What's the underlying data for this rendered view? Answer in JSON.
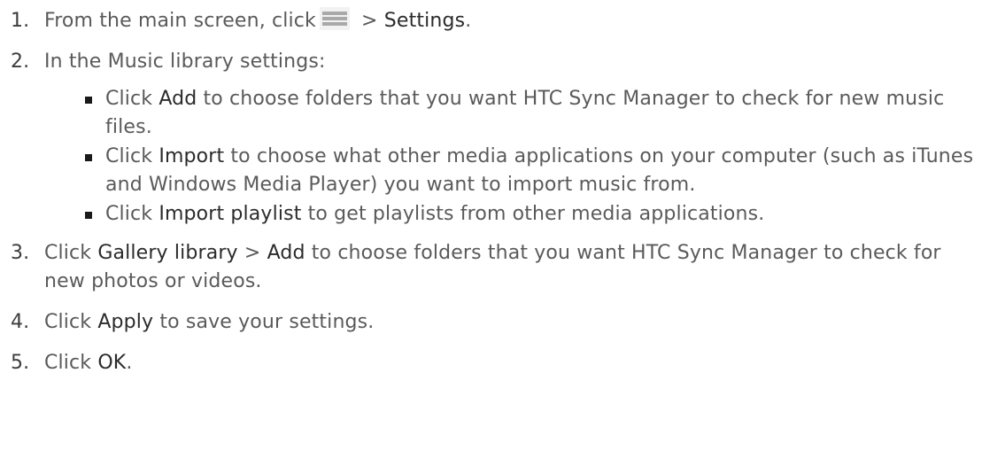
{
  "steps": [
    {
      "num": "1.",
      "t1": "From the main screen, click",
      "t2": " > ",
      "kw1": "Settings",
      "t3": "."
    },
    {
      "num": "2.",
      "t1": "In the Music library settings:",
      "bullets": [
        {
          "pre": "Click ",
          "kw": "Add",
          "post": " to choose folders that you want HTC Sync Manager to check for new music files."
        },
        {
          "pre": "Click ",
          "kw": "Import",
          "post": " to choose what other media applications on your computer (such as iTunes and Windows Media Player) you want to import music from."
        },
        {
          "pre": "Click ",
          "kw": "Import playlist",
          "post": " to get playlists from other media applications."
        }
      ]
    },
    {
      "num": "3.",
      "pre": "Click ",
      "kw1": "Gallery library",
      "mid": " > ",
      "kw2": "Add",
      "post": " to choose folders that you want HTC Sync Manager to check for new photos or videos."
    },
    {
      "num": "4.",
      "pre": "Click ",
      "kw": "Apply",
      "post": " to save your settings."
    },
    {
      "num": "5.",
      "pre": "Click ",
      "kw": "OK",
      "post": "."
    }
  ],
  "icons": {
    "menu": "hamburger-menu-icon"
  }
}
